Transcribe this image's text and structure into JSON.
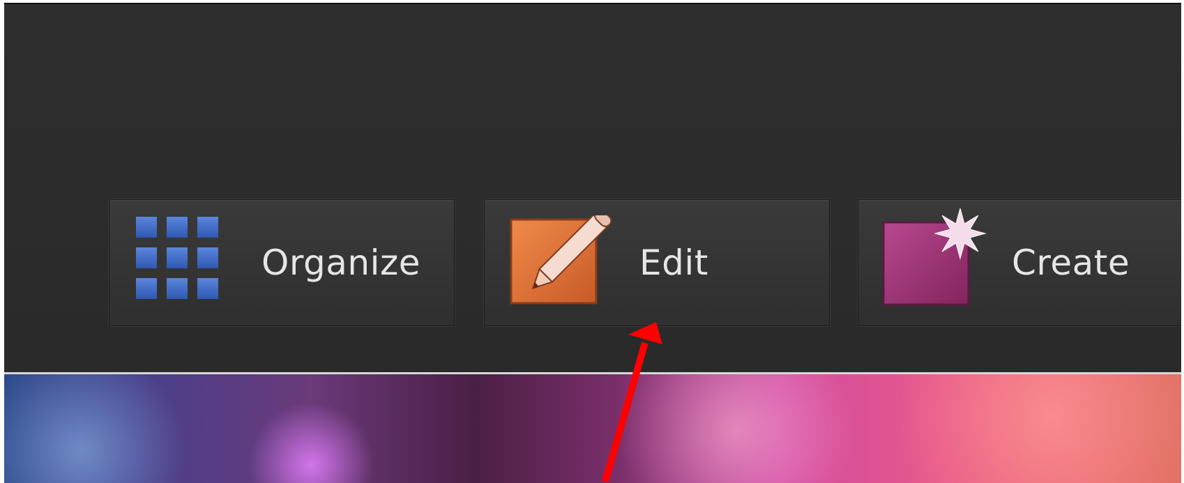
{
  "toolbar": {
    "buttons": [
      {
        "label": "Organize",
        "icon": "organize-grid-icon"
      },
      {
        "label": "Edit",
        "icon": "edit-pencil-icon"
      },
      {
        "label": "Create",
        "icon": "create-star-icon"
      }
    ]
  },
  "colors": {
    "toolbar_bg": "#2d2d2d",
    "organize_icon": "#3a66c2",
    "edit_icon": "#e0733a",
    "create_icon": "#a23a7e",
    "annotation_arrow": "#ff0000"
  },
  "annotation": {
    "type": "arrow",
    "points_to": "Edit"
  }
}
